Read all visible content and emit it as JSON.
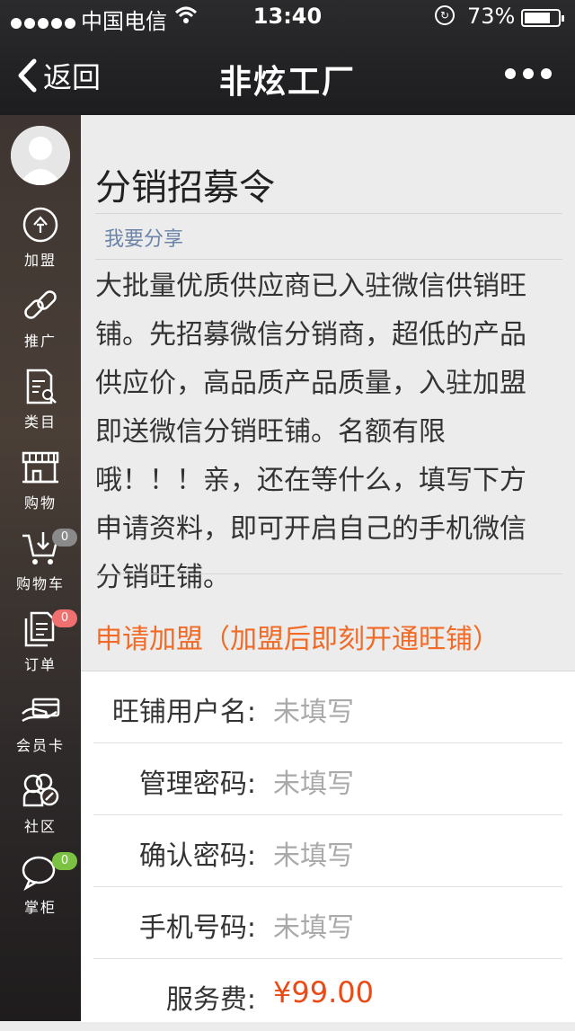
{
  "status_bar": {
    "carrier": "中国电信",
    "time": "13:40",
    "battery": "73%"
  },
  "nav": {
    "back_label": "返回",
    "title": "非炫工厂"
  },
  "sidebar": {
    "items": [
      {
        "label": "加盟",
        "icon": "join-icon"
      },
      {
        "label": "推广",
        "icon": "link-icon"
      },
      {
        "label": "类目",
        "icon": "category-icon"
      },
      {
        "label": "购物",
        "icon": "store-icon"
      },
      {
        "label": "购物车",
        "icon": "cart-icon",
        "badge": "0"
      },
      {
        "label": "订单",
        "icon": "order-icon",
        "badge": "0"
      },
      {
        "label": "会员卡",
        "icon": "member-card-icon"
      },
      {
        "label": "社区",
        "icon": "community-icon"
      },
      {
        "label": "掌柜",
        "icon": "chat-icon",
        "badge": "0"
      }
    ]
  },
  "article": {
    "title": "分销招募令",
    "share": "我要分享",
    "body_lines": [
      "大批量优质供应商已入驻微信供销旺",
      "铺。先招募微信分销商，超低的产品",
      "供应价，高品质产品质量，入驻加盟",
      "即送微信分销旺铺。名额有限",
      "哦！！！亲，还在等什么，填写下方",
      "申请资料，即可开启自己的手机微信",
      "分销旺铺。"
    ]
  },
  "apply": {
    "title": "申请加盟（加盟后即刻开通旺铺）",
    "fields": [
      {
        "label": "旺铺用户名:",
        "value": "未填写"
      },
      {
        "label": "管理密码:",
        "value": "未填写"
      },
      {
        "label": "确认密码:",
        "value": "未填写"
      },
      {
        "label": "手机号码:",
        "value": "未填写"
      },
      {
        "label": "服务费:",
        "value": "¥99.00"
      }
    ]
  },
  "colors": {
    "accent": "#f26a25",
    "price": "#ea4a16",
    "link": "#6c84a8",
    "badge_grey": "#8a8a8a",
    "badge_red": "#f07070",
    "badge_green": "#7cc242"
  }
}
